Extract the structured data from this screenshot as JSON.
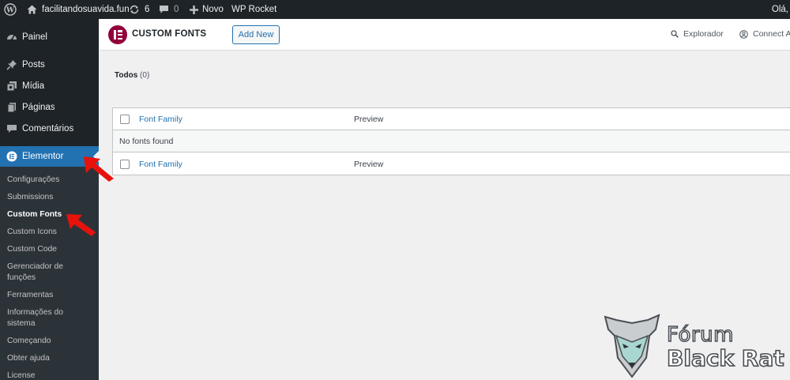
{
  "admin_bar": {
    "site_name": "facilitandosuavida.fun",
    "updates_count": "6",
    "comments_count": "0",
    "new_label": "Novo",
    "plugin_label": "WP Rocket",
    "greeting": "Olá,"
  },
  "sidebar": {
    "items": [
      {
        "label": "Painel",
        "icon": "dashboard-icon"
      },
      {
        "label": "Posts",
        "icon": "pin-icon"
      },
      {
        "label": "Mídia",
        "icon": "media-icon"
      },
      {
        "label": "Páginas",
        "icon": "pages-icon"
      },
      {
        "label": "Comentários",
        "icon": "comments-icon"
      }
    ],
    "active": {
      "label": "Elementor",
      "icon": "elementor-icon"
    },
    "submenu": [
      "Configurações",
      "Submissions",
      "Custom Fonts",
      "Custom Icons",
      "Custom Code",
      "Gerenciador de funções",
      "Ferramentas",
      "Informações do sistema",
      "Começando",
      "Obter ajuda",
      "License"
    ],
    "current_submenu": "Custom Fonts"
  },
  "header": {
    "title": "CUSTOM FONTS",
    "add_new_label": "Add New",
    "explorer_label": "Explorador",
    "connect_label": "Connect A"
  },
  "filter": {
    "label": "Todos",
    "count": "(0)"
  },
  "table": {
    "columns": [
      "Font Family",
      "Preview"
    ],
    "empty_message": "No fonts found"
  },
  "watermark": {
    "line1": "Fórum",
    "line2": "Black Rat"
  },
  "colors": {
    "admin_dark": "#1d2327",
    "accent_blue": "#2271b1",
    "elementor_brand": "#92003b",
    "annotation_red": "#e8120c"
  }
}
